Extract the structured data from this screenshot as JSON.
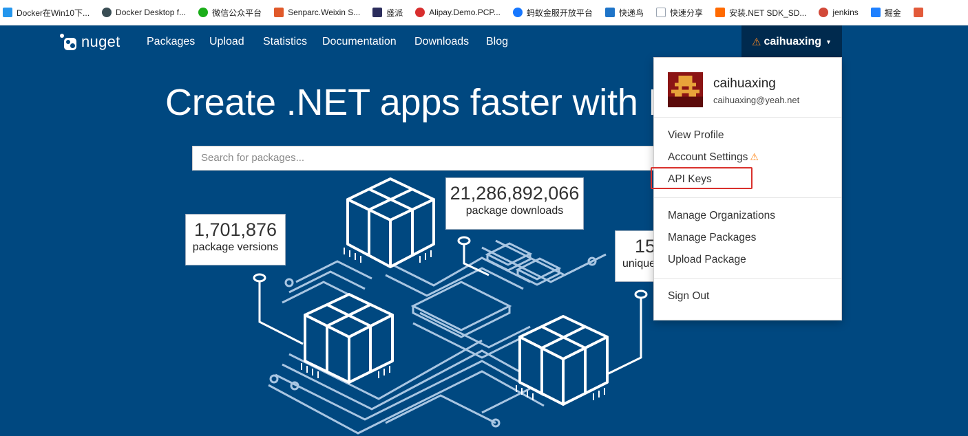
{
  "bookmarks": [
    {
      "label": "Docker在Win10下...",
      "color": "#2496ed"
    },
    {
      "label": "Docker Desktop f...",
      "color": "#394d54"
    },
    {
      "label": "微信公众平台",
      "color": "#1aad19"
    },
    {
      "label": "Senparc.Weixin S...",
      "color": "#e0592a"
    },
    {
      "label": "盛派",
      "color": "#2b2d5c"
    },
    {
      "label": "Alipay.Demo.PCP...",
      "color": "#d82e2e"
    },
    {
      "label": "蚂蚁金服开放平台",
      "color": "#1677ff"
    },
    {
      "label": "快递鸟",
      "color": "#1e74c8"
    },
    {
      "label": "快速分享",
      "color": "#9aa4b1"
    },
    {
      "label": "安装.NET SDK_SD...",
      "color": "#ff6a00"
    },
    {
      "label": "jenkins",
      "color": "#d24939"
    },
    {
      "label": "掘金",
      "color": "#1e80ff"
    },
    {
      "label": "",
      "color": "#e25a3a"
    }
  ],
  "nav": {
    "brand": "nuget",
    "links": [
      "Packages",
      "Upload",
      "Statistics",
      "Documentation",
      "Downloads",
      "Blog"
    ],
    "user": "caihuaxing"
  },
  "hero": {
    "title": "Create .NET apps faster with N",
    "search_placeholder": "Search for packages..."
  },
  "stats": {
    "versions": {
      "value": "1,701,876",
      "label": "package versions"
    },
    "downloads": {
      "value": "21,286,892,066",
      "label": "package downloads"
    },
    "unique": {
      "value": "15",
      "label": "unique"
    }
  },
  "menu": {
    "name": "caihuaxing",
    "email": "caihuaxing@yeah.net",
    "items": {
      "view_profile": "View Profile",
      "account_settings": "Account Settings",
      "api_keys": "API Keys",
      "manage_orgs": "Manage Organizations",
      "manage_packages": "Manage Packages",
      "upload_package": "Upload Package",
      "sign_out": "Sign Out"
    }
  },
  "colors": {
    "brand_blue": "#004880",
    "nav_active": "#002a4e",
    "warning": "#ff8a1e",
    "highlight": "#d9302c",
    "avatar_red": "#8b1414",
    "avatar_gold": "#e8a33a"
  }
}
